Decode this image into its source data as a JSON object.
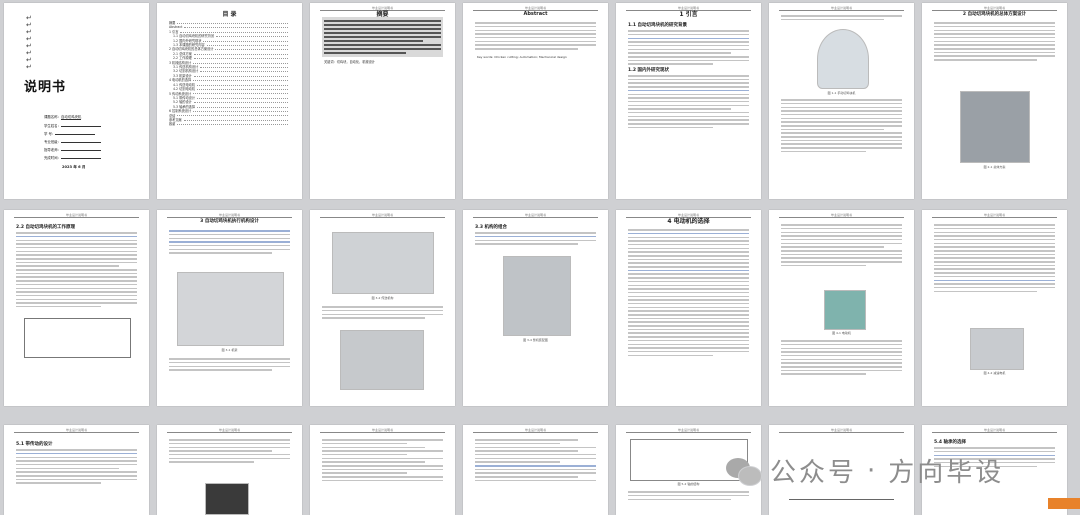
{
  "cover": {
    "title": "说明书",
    "fields": [
      "课题名称：",
      "学生姓名：",
      "学    号：",
      "专业班级：",
      "指导老师：",
      "完成时间：",
      "指导教师："
    ],
    "project_name": "自动切鸡块机",
    "date": "2023 年 6 月"
  },
  "toc": {
    "title": "目  录",
    "items": [
      "摘要",
      "Abstract",
      "1 引言",
      "1.1 自动切鸡块机的研究背景",
      "1.2 国内外研究现状",
      "1.3 本课题的研究内容",
      "2 自动切鸡块机的总体方案设计",
      "2.1 总体方案",
      "2.2 工作原理",
      "3 机械结构设计",
      "3.1 传送机构设计",
      "3.2 切割机构设计",
      "3.3 机架设计",
      "4 电动机的选择",
      "4.1 传送电动机",
      "4.2 切割电动机",
      "5 传动系统设计",
      "5.1 带传动设计",
      "5.2 轴的设计",
      "5.3 轴承的选择",
      "6 控制系统设计",
      "总结",
      "参考文献",
      "致谢"
    ]
  },
  "abstract_cn": {
    "title": "摘要",
    "keywords": "关键词：切鸡块，自动化，机械设计"
  },
  "abstract_en": {
    "title": "Abstract",
    "keywords": "Key words: Chicken cutting; Automation; Mechanical design"
  },
  "pages": {
    "p4_title": "1 引言",
    "p4_h": [
      "1.1 自动切鸡块机的研究背景",
      "1.2 国内外研究现状"
    ],
    "p5_cap": "图 1-1 手动切鸡块机",
    "p6_cap": "图 1-2 自动切肉机",
    "p7_title": "2 自动切鸡块机的总体方案设计",
    "p7_cap": "图 2-1 总体方案",
    "p8_h": "2.2 自动切鸡块机的工作原理",
    "p9_title": "3 自动切鸡块机执行机构设计",
    "p9_cap": "图 3-1 机架",
    "p10_cap": "图 3-2 传送机构",
    "p11_h": "3.3 机构的组合",
    "p11_cap": "图 3-4 整机装配图",
    "p12_title": "4 电动机的选择",
    "p12_cap": "图 4-1 电动机",
    "p14_cap": "图 4-2 减速电机",
    "p15_h": "5.1 带传动的设计",
    "p17_cap": "图 5-2 轴的结构",
    "p20_h": "5.4 轴承的选择"
  },
  "watermark": {
    "platform": "公众号",
    "name": "方向毕设"
  },
  "header_text": "毕业设计说明书"
}
